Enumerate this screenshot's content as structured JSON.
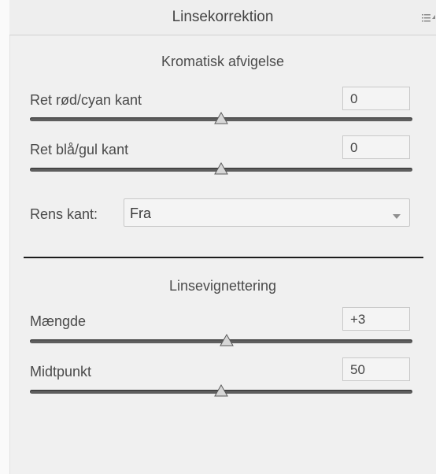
{
  "panel": {
    "title": "Linsekorrektion",
    "menu_icon": "panel-menu-icon"
  },
  "chromatic": {
    "heading": "Kromatisk afvigelse",
    "red_cyan": {
      "label": "Ret rød/cyan kant",
      "value": "0",
      "slider_fraction": 0.5
    },
    "blue_yellow": {
      "label": "Ret blå/gul kant",
      "value": "0",
      "slider_fraction": 0.5
    },
    "defringe": {
      "label": "Rens kant:",
      "selected": "Fra"
    }
  },
  "vignetting": {
    "heading": "Linsevignettering",
    "amount": {
      "label": "Mængde",
      "value": "+3",
      "slider_fraction": 0.515
    },
    "midpoint": {
      "label": "Midtpunkt",
      "value": "50",
      "slider_fraction": 0.5
    }
  },
  "colors": {
    "background": "#f0f0f0",
    "track": "#5e5e5e",
    "divider": "#1c1c1c"
  }
}
